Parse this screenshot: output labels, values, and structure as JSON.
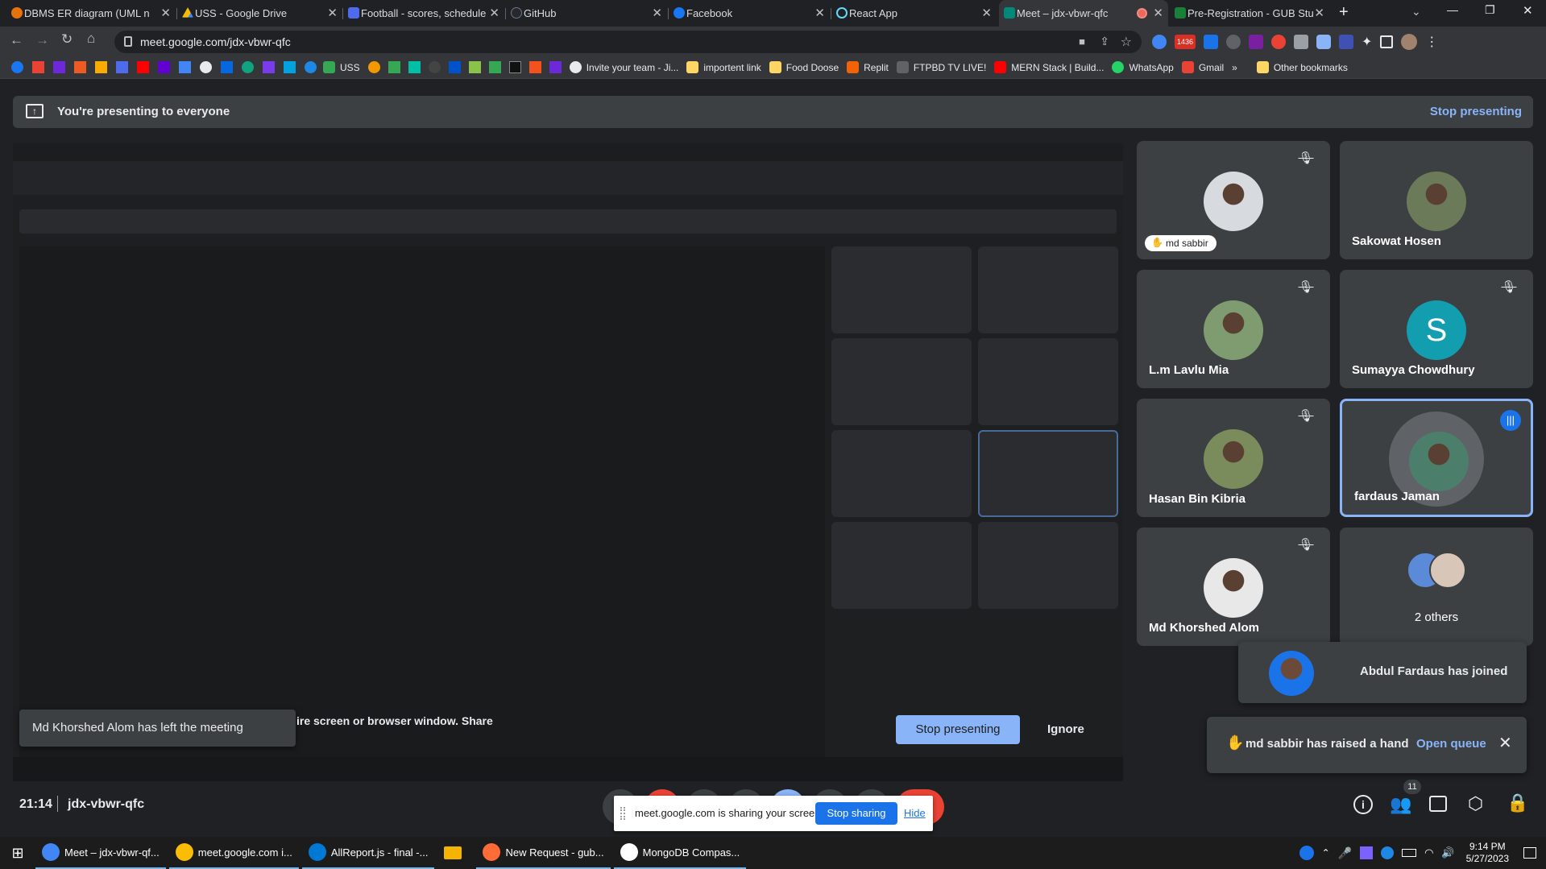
{
  "browser": {
    "tabs": [
      {
        "title": "DBMS ER diagram (UML n",
        "fav": "#e8710a"
      },
      {
        "title": "USS - Google Drive",
        "fav": "#34a853"
      },
      {
        "title": "Football - scores, schedule",
        "fav": "#4f6bed"
      },
      {
        "title": "GitHub",
        "fav": "#24292f"
      },
      {
        "title": "Facebook",
        "fav": "#1877f2"
      },
      {
        "title": "React App",
        "fav": "#61dafb"
      },
      {
        "title": "Meet – jdx-vbwr-qfc",
        "fav": "#00897b"
      },
      {
        "title": "Pre-Registration - GUB Stu",
        "fav": "#188038"
      }
    ],
    "new_tab_label": "+",
    "url": "meet.google.com/jdx-vbwr-qfc",
    "extension_badge": "1436",
    "bookmarks": [
      "USS",
      "Invite your team - Ji...",
      "importent link",
      "Food Doose",
      "Replit",
      "FTPBD TV LIVE!",
      "MERN Stack | Build...",
      "WhatsApp",
      "Gmail"
    ],
    "bookmarks_overflow": "»",
    "other_bookmarks": "Other bookmarks"
  },
  "meet": {
    "banner_text": "You're presenting to everyone",
    "banner_stop": "Stop presenting",
    "participants": [
      {
        "name": "md sabbir",
        "muted": true,
        "hand": true,
        "avatar_color": "#d7dadf"
      },
      {
        "name": "Sakowat Hosen",
        "muted": false,
        "avatar_color": "#6b7a58"
      },
      {
        "name": "L.m Lavlu Mia",
        "muted": true,
        "avatar_color": "#7f9c71"
      },
      {
        "name": "Sumayya Chowdhury",
        "muted": true,
        "initial": "S",
        "avatar_color": "#129eaf"
      },
      {
        "name": "Hasan Bin Kibria",
        "muted": true,
        "avatar_color": "#7a8c5b"
      },
      {
        "name": "fardaus Jaman",
        "muted": false,
        "speaking": true,
        "avatar_color": "#4b7f6b"
      },
      {
        "name": "Md Khorshed Alom",
        "muted": true,
        "avatar_color": "#e8e8e8"
      },
      {
        "name": "2 others",
        "muted": false,
        "avatar_color": "#5b8bd8"
      }
    ],
    "toast_left": "Md Khorshed Alom has left the meeting",
    "share_hint": "ire screen or browser window. Share",
    "stop_presenting_btn": "Stop presenting",
    "ignore_btn": "Ignore",
    "joined_toast": "Abdul Fardaus has joined",
    "hand_toast": "md sabbir has raised a hand",
    "open_queue": "Open queue",
    "time": "21:14",
    "meeting_code": "jdx-vbwr-qfc",
    "people_count": "11",
    "sharing_text": "meet.google.com is sharing your screen.",
    "stop_sharing": "Stop sharing",
    "hide": "Hide"
  },
  "taskbar": {
    "items": [
      {
        "label": "Meet – jdx-vbwr-qf...",
        "color": "#4285f4"
      },
      {
        "label": "meet.google.com i...",
        "color": "#fbbc04"
      },
      {
        "label": "AllReport.js - final -...",
        "color": "#0078d4"
      },
      {
        "label": "",
        "color": "#f4b400"
      },
      {
        "label": "New Request - gub...",
        "color": "#ff6c37"
      },
      {
        "label": "MongoDB Compas...",
        "color": "#ffffff"
      }
    ],
    "time": "9:14 PM",
    "date": "5/27/2023"
  }
}
